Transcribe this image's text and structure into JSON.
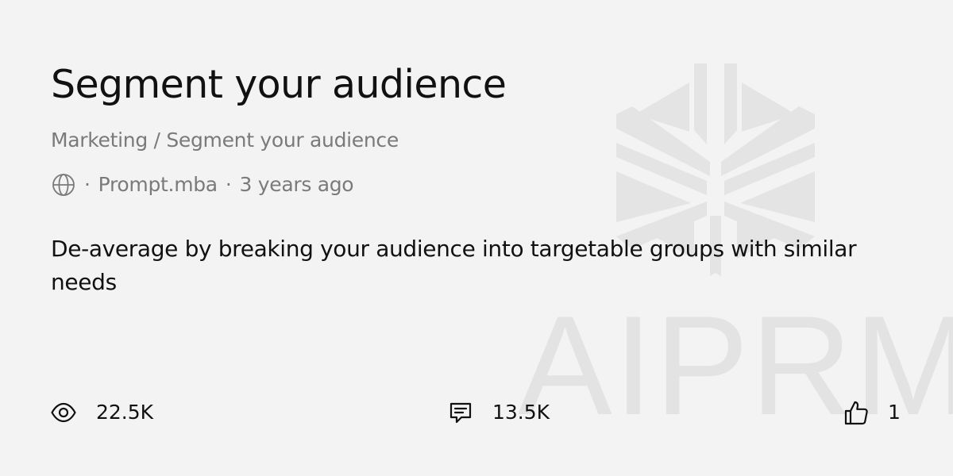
{
  "page": {
    "title": "Segment your audience",
    "breadcrumb": "Marketing / Segment your audience",
    "meta": {
      "icon": "globe-icon",
      "separator": "·",
      "author": "Prompt.mba",
      "age": "3 years ago"
    },
    "description": "De-average by breaking your audience into targetable groups with similar needs"
  },
  "stats": {
    "views": {
      "icon": "eye-icon",
      "value": "22.5K"
    },
    "comments": {
      "icon": "comment-icon",
      "value": "13.5K"
    },
    "likes": {
      "icon": "thumbs-up-icon",
      "value": "1"
    }
  },
  "watermark": {
    "text": "AIPRM",
    "icon": "aiprm-logo-icon"
  },
  "colors": {
    "background": "#f3f3f3",
    "text": "#111111",
    "muted": "#7a7a7a",
    "watermark": "#e3e3e3"
  }
}
